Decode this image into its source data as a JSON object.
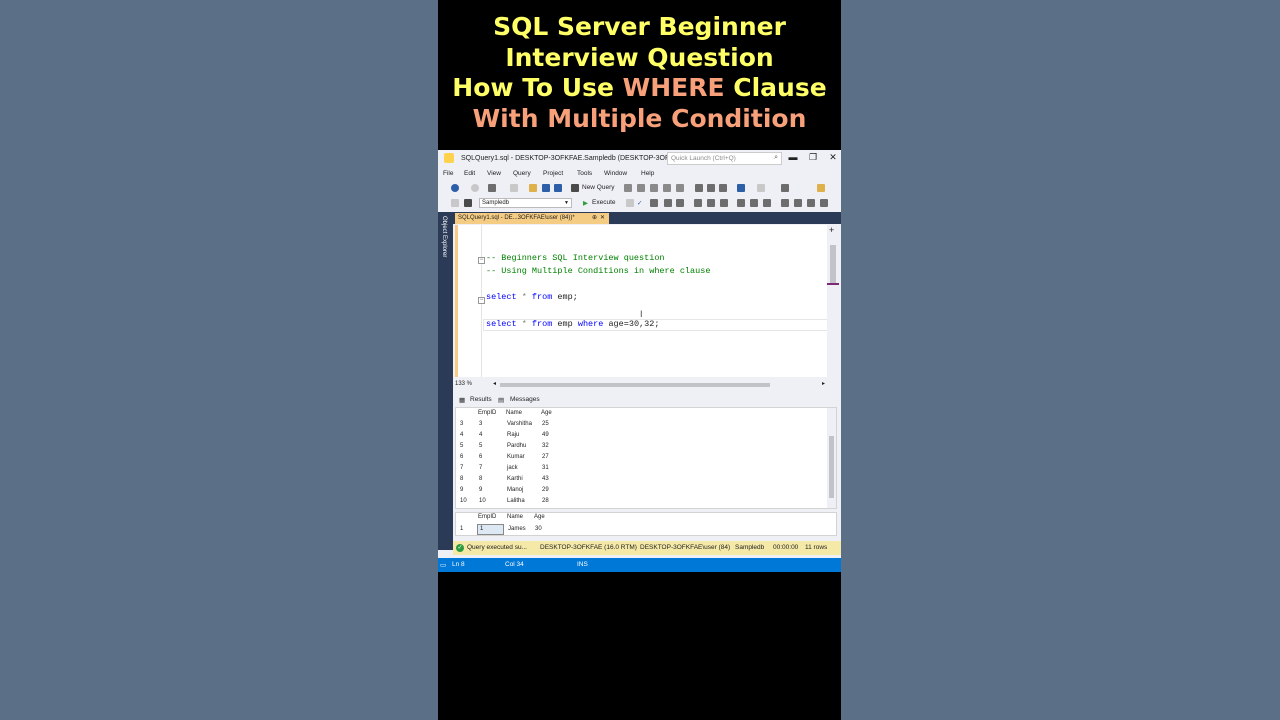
{
  "video_title": {
    "line1": "SQL Server Beginner",
    "line2": "Interview Question",
    "line3_pre": "How To Use ",
    "line3_highlight": "WHERE",
    "line3_post": " Clause",
    "line4": "With Multiple Condition"
  },
  "colors": {
    "title_yellow": "#ffff66",
    "title_highlight": "#f7a07a",
    "status_blue": "#0078d7",
    "tab_gold": "#f5cc84"
  },
  "window": {
    "title": "SQLQuery1.sql - DESKTOP-3OFKFAE.Sampledb (DESKTOP-3OFKF...",
    "quick_launch_placeholder": "Quick Launch (Ctrl+Q)",
    "minimize": "▬",
    "maximize": "❐",
    "close": "✕"
  },
  "menu": [
    "File",
    "Edit",
    "View",
    "Query",
    "Project",
    "Tools",
    "Window",
    "Help"
  ],
  "toolbar": {
    "new_query": "New Query",
    "database": "Sampledb",
    "execute": "Execute"
  },
  "object_explorer": "Object Explorer",
  "editor_tab": {
    "label": "SQLQuery1.sql - DE...3OFKFAE\\user (84))*",
    "pin": "⊕",
    "close": "✕"
  },
  "code": {
    "comment1": "-- Beginners SQL Interview question",
    "comment2": "-- Using Multiple Conditions in where clause",
    "q1_select": "select",
    "q1_star": " * ",
    "q1_from": "from",
    "q1_rest": " emp;",
    "q2_select": "select",
    "q2_star": " * ",
    "q2_from": "from",
    "q2_emp": " emp ",
    "q2_where": "where",
    "q2_rest": " age=30,32;"
  },
  "zoom": "133 %",
  "results_tabs": {
    "results": "Results",
    "messages": "Messages"
  },
  "grid1": {
    "columns": [
      "EmpID",
      "Name",
      "Age"
    ],
    "rows": [
      [
        "3",
        "3",
        "Varshitha",
        "25"
      ],
      [
        "4",
        "4",
        "Raju",
        "49"
      ],
      [
        "5",
        "5",
        "Pardhu",
        "32"
      ],
      [
        "6",
        "6",
        "Kumar",
        "27"
      ],
      [
        "7",
        "7",
        "jack",
        "31"
      ],
      [
        "8",
        "8",
        "Karthi",
        "43"
      ],
      [
        "9",
        "9",
        "Manoj",
        "29"
      ],
      [
        "10",
        "10",
        "Lalitha",
        "28"
      ]
    ]
  },
  "grid2": {
    "columns": [
      "EmpID",
      "Name",
      "Age"
    ],
    "rows": [
      [
        "1",
        "1",
        "James",
        "30"
      ]
    ]
  },
  "query_status": {
    "message": "Query executed su...",
    "server": "DESKTOP-3OFKFAE (16.0 RTM)",
    "user": "DESKTOP-3OFKFAE\\user (84)",
    "db": "Sampledb",
    "time": "00:00:00",
    "rows": "11 rows"
  },
  "status_bar": {
    "ln": "Ln 8",
    "col": "Col 34",
    "mode": "INS"
  }
}
